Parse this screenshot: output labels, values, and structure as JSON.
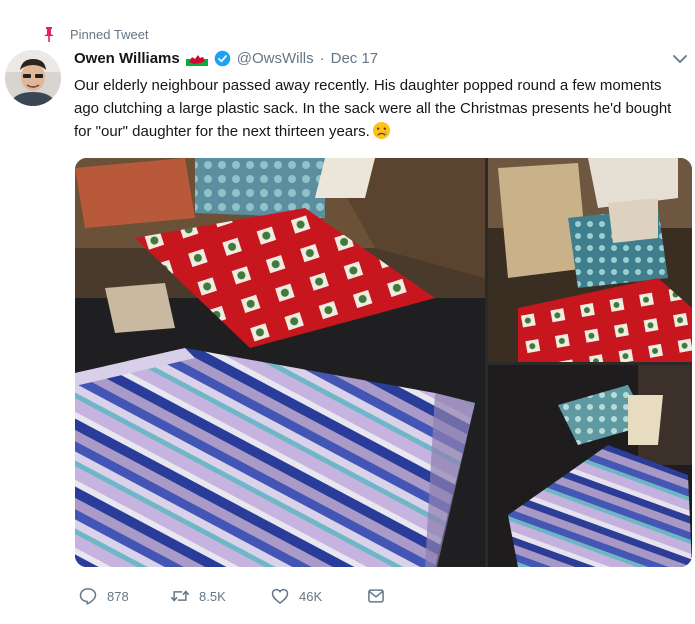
{
  "pinned": {
    "label": "Pinned Tweet",
    "icon": "pin-icon"
  },
  "author": {
    "name": "Owen Williams",
    "handle": "@OwsWills",
    "separator": "·",
    "date": "Dec 17",
    "flag_icon": "wales-flag-icon",
    "verified_icon": "verified-badge-icon"
  },
  "tweet": {
    "text": "Our elderly neighbour passed away recently. His daughter popped round a few moments ago clutching a large plastic sack. In the sack were all the Christmas presents he'd bought for \"our\" daughter for the next thirteen years.",
    "emoji": "crying-face-emoji"
  },
  "media": {
    "images": [
      "wrapped-presents-striped",
      "wrapped-presents-stack",
      "wrapped-presents-closeup"
    ]
  },
  "actions": {
    "reply_count": "878",
    "retweet_count": "8.5K",
    "like_count": "46K"
  },
  "colors": {
    "text": "#14171a",
    "secondary": "#657786",
    "verified": "#1da1f2",
    "pin": "#e0245e"
  }
}
